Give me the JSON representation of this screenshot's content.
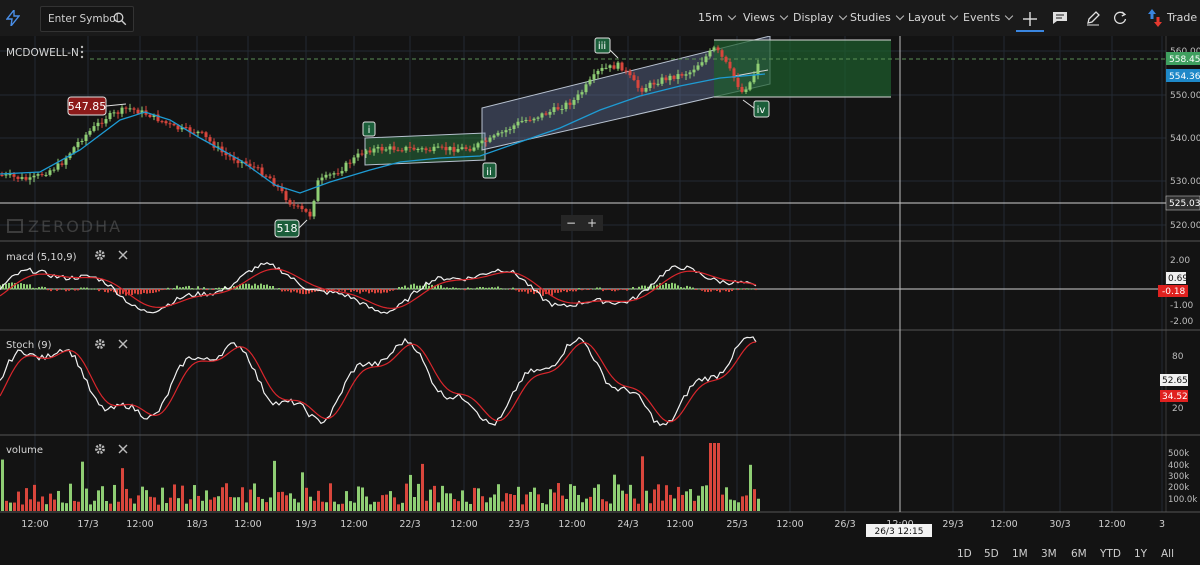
{
  "toolbar": {
    "search_placeholder": "Enter Symbol",
    "interval": "15m",
    "views": "Views",
    "display": "Display",
    "studies": "Studies",
    "layout": "Layout",
    "events": "Events",
    "trade": "Trade"
  },
  "chart": {
    "symbol": "MCDOWELL-N",
    "watermark": "ZERODHA",
    "zoom_out": "−",
    "zoom_in": "+",
    "price_axis": [
      "560.00",
      "550.00",
      "540.00",
      "530.00",
      "520.00"
    ],
    "price_badges": [
      {
        "label": "558.45",
        "color": "#3f9f5f"
      },
      {
        "label": "554.36",
        "color": "#1e88c8"
      },
      {
        "label": "525.03",
        "color": "#2e2e2e"
      }
    ],
    "annotations": {
      "high_label": "547.85",
      "low_label": "518",
      "wave_i": "i",
      "wave_ii": "ii",
      "wave_iii": "iii",
      "wave_iv": "iv"
    },
    "crosshair_date": "26/3 12:15",
    "time_axis": [
      "12:00",
      "17/3",
      "12:00",
      "18/3",
      "12:00",
      "19/3",
      "12:00",
      "22/3",
      "12:00",
      "23/3",
      "12:00",
      "24/3",
      "12:00",
      "25/3",
      "12:00",
      "26/3",
      "12:00",
      "29/3",
      "12:00",
      "30/3",
      "12:00",
      "3"
    ]
  },
  "studies": {
    "macd": {
      "label": "macd (5,10,9)",
      "axis": [
        "2.00",
        "1.00",
        "-1.00",
        "-2.00"
      ],
      "badge_a": "0.69",
      "badge_b": "-0.18"
    },
    "stoch": {
      "label": "Stoch (9)",
      "axis": [
        "80",
        "20"
      ],
      "badge_a": "52.65",
      "badge_b": "34.52"
    },
    "volume": {
      "label": "volume",
      "axis": [
        "500k",
        "400k",
        "300k",
        "200k",
        "100.0k"
      ]
    }
  },
  "ranges": [
    "1D",
    "5D",
    "1M",
    "3M",
    "6M",
    "YTD",
    "1Y",
    "All"
  ],
  "colors": {
    "up": "#8fce74",
    "down": "#d9463c",
    "ma": "#1e9bd3",
    "signal": "#d9262c",
    "macd_line": "#f2f2f2"
  }
}
